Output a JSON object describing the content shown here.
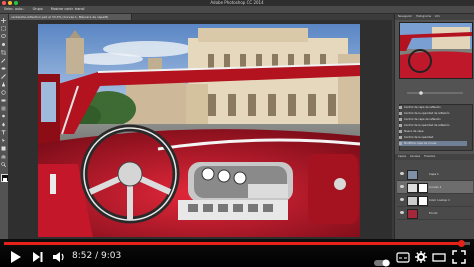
{
  "window": {
    "title": "Adobe Photoshop CC 2014",
    "document_tab": "ventanilla-reflection.psd al 33,3% (Curvas 1, Máscara de capa/8)"
  },
  "options_bar": {
    "items": [
      "Selec. auto.:",
      "Grupo",
      "Mostrar contr. transf."
    ]
  },
  "panel": {
    "tabs": [
      "Navegador",
      "Histograma",
      "Info"
    ],
    "history_items": [
      "Control de capa de reflexión",
      "Control de la opacidad de reflexión",
      "Control de capa de reflexión",
      "Control de la opacidad de reflexión",
      "Nuevo de capa",
      "Control de la opacidad",
      "Modificar capa de curvas"
    ],
    "layers_tabs": [
      "Capas",
      "Canales",
      "Trazados"
    ],
    "layers": [
      {
        "name": "Capa 1"
      },
      {
        "name": "Curvas 1"
      },
      {
        "name": "Color Lookup 1"
      },
      {
        "name": "Fondo"
      }
    ]
  },
  "video": {
    "current_time": "8:52",
    "separator": " / ",
    "duration": "9:03",
    "progress": 0.981
  },
  "colors": {
    "accent": "#e62117",
    "chrome_dark": "#2f2f2f",
    "panel": "#535353"
  }
}
